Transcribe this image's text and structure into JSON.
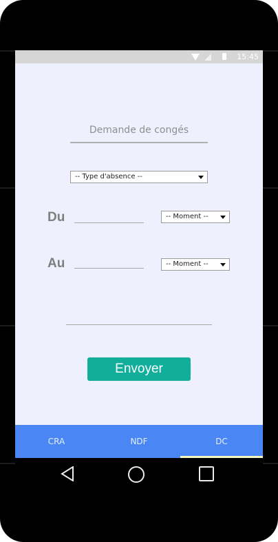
{
  "status_bar": {
    "time": "15:45",
    "icons": [
      "wifi-icon",
      "signal-icon",
      "battery-icon"
    ]
  },
  "form": {
    "title": "Demande de congés",
    "absence_type": {
      "selected": "-- Type d'absence --"
    },
    "from": {
      "label": "Du",
      "date_value": "",
      "moment_selected": "-- Moment --"
    },
    "to": {
      "label": "Au",
      "date_value": "",
      "moment_selected": "-- Moment --"
    },
    "comment_value": "",
    "submit_label": "Envoyer"
  },
  "tabs": [
    {
      "label": "CRA",
      "active": false
    },
    {
      "label": "NDF",
      "active": false
    },
    {
      "label": "DC",
      "active": true
    }
  ],
  "navigation": [
    "back-icon",
    "home-icon",
    "recents-icon"
  ],
  "colors": {
    "screen_background": "#eef0fd",
    "tab_bar": "#4a87f4",
    "tab_indicator": "#f6f7bf",
    "submit_button": "#12ae9c",
    "label_text": "#7f7f7f"
  }
}
